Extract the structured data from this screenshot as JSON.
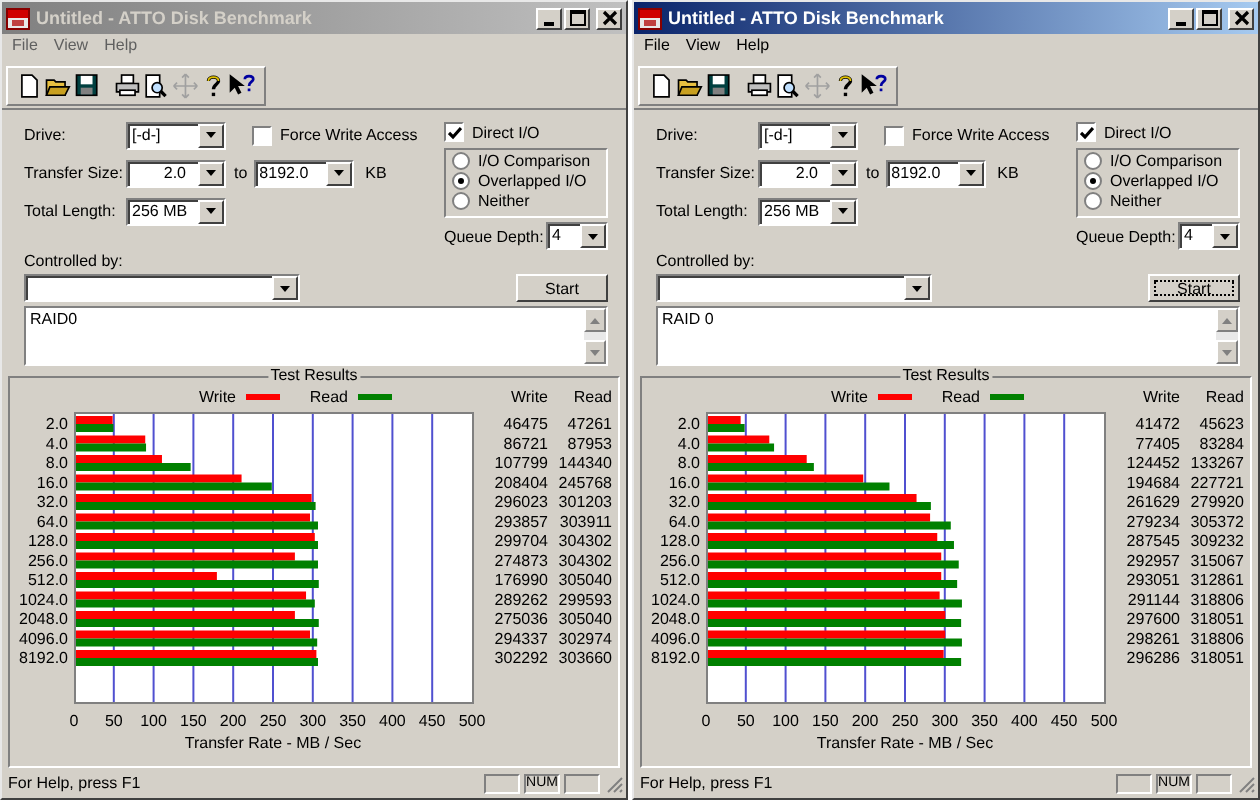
{
  "windows": [
    {
      "title": "Untitled - ATTO Disk Benchmark",
      "active": false,
      "menu": [
        "File",
        "View",
        "Help"
      ],
      "form": {
        "drive_label": "Drive:",
        "drive": "[-d-]",
        "transfer_size_label": "Transfer Size:",
        "transfer_from": "2.0",
        "to_label": "to",
        "transfer_to": "8192.0",
        "unit": "KB",
        "total_length_label": "Total Length:",
        "total_length": "256 MB",
        "force_write": {
          "label": "Force Write Access",
          "checked": false
        },
        "direct_io": {
          "label": "Direct I/O",
          "checked": true
        },
        "modes": [
          {
            "label": "I/O Comparison",
            "selected": false
          },
          {
            "label": "Overlapped I/O",
            "selected": true
          },
          {
            "label": "Neither",
            "selected": false
          }
        ],
        "queue_depth_label": "Queue Depth:",
        "queue_depth": "4",
        "controlled_by_label": "Controlled by:",
        "start_button": "Start",
        "description": "RAID0"
      },
      "results": {
        "title": "Test Results",
        "columns": [
          "Write",
          "Read"
        ],
        "rows": [
          {
            "write": "46475",
            "read": "47261"
          },
          {
            "write": "86721",
            "read": "87953"
          },
          {
            "write": "107799",
            "read": "144340"
          },
          {
            "write": "208404",
            "read": "245768"
          },
          {
            "write": "296023",
            "read": "301203"
          },
          {
            "write": "293857",
            "read": "303911"
          },
          {
            "write": "299704",
            "read": "304302"
          },
          {
            "write": "274873",
            "read": "304302"
          },
          {
            "write": "176990",
            "read": "305040"
          },
          {
            "write": "289262",
            "read": "299593"
          },
          {
            "write": "275036",
            "read": "305040"
          },
          {
            "write": "294337",
            "read": "302974"
          },
          {
            "write": "302292",
            "read": "303660"
          }
        ],
        "chart_data": {
          "type": "bar",
          "orientation": "horizontal",
          "xlabel": "Transfer Rate - MB / Sec",
          "categories": [
            "2.0",
            "4.0",
            "8.0",
            "16.0",
            "32.0",
            "64.0",
            "128.0",
            "256.0",
            "512.0",
            "1024.0",
            "2048.0",
            "4096.0",
            "8192.0"
          ],
          "xlim": [
            0,
            500
          ],
          "xticks": [
            0,
            50,
            100,
            150,
            200,
            250,
            300,
            350,
            400,
            450,
            500
          ],
          "series": [
            {
              "name": "Write",
              "color": "#ff0000",
              "values": [
                46,
                87,
                108,
                208,
                296,
                294,
                300,
                275,
                177,
                289,
                275,
                294,
                302
              ]
            },
            {
              "name": "Read",
              "color": "#008000",
              "values": [
                47,
                88,
                144,
                246,
                301,
                304,
                304,
                304,
                305,
                300,
                305,
                303,
                304
              ]
            }
          ],
          "grid": true,
          "legend": true
        }
      },
      "status": {
        "text": "For Help, press F1",
        "indicator": "NUM"
      }
    },
    {
      "title": "Untitled - ATTO Disk Benchmark",
      "active": true,
      "menu": [
        "File",
        "View",
        "Help"
      ],
      "form": {
        "drive_label": "Drive:",
        "drive": "[-d-]",
        "transfer_size_label": "Transfer Size:",
        "transfer_from": "2.0",
        "to_label": "to",
        "transfer_to": "8192.0",
        "unit": "KB",
        "total_length_label": "Total Length:",
        "total_length": "256 MB",
        "force_write": {
          "label": "Force Write Access",
          "checked": false
        },
        "direct_io": {
          "label": "Direct I/O",
          "checked": true
        },
        "modes": [
          {
            "label": "I/O Comparison",
            "selected": false
          },
          {
            "label": "Overlapped I/O",
            "selected": true
          },
          {
            "label": "Neither",
            "selected": false
          }
        ],
        "queue_depth_label": "Queue Depth:",
        "queue_depth": "4",
        "controlled_by_label": "Controlled by:",
        "start_button": "Start",
        "description": "RAID 0"
      },
      "results": {
        "title": "Test Results",
        "columns": [
          "Write",
          "Read"
        ],
        "rows": [
          {
            "write": "41472",
            "read": "45623"
          },
          {
            "write": "77405",
            "read": "83284"
          },
          {
            "write": "124452",
            "read": "133267"
          },
          {
            "write": "194684",
            "read": "227721"
          },
          {
            "write": "261629",
            "read": "279920"
          },
          {
            "write": "279234",
            "read": "305372"
          },
          {
            "write": "287545",
            "read": "309232"
          },
          {
            "write": "292957",
            "read": "315067"
          },
          {
            "write": "293051",
            "read": "312861"
          },
          {
            "write": "291144",
            "read": "318806"
          },
          {
            "write": "297600",
            "read": "318051"
          },
          {
            "write": "298261",
            "read": "318806"
          },
          {
            "write": "296286",
            "read": "318051"
          }
        ],
        "chart_data": {
          "type": "bar",
          "orientation": "horizontal",
          "xlabel": "Transfer Rate - MB / Sec",
          "categories": [
            "2.0",
            "4.0",
            "8.0",
            "16.0",
            "32.0",
            "64.0",
            "128.0",
            "256.0",
            "512.0",
            "1024.0",
            "2048.0",
            "4096.0",
            "8192.0"
          ],
          "xlim": [
            0,
            500
          ],
          "xticks": [
            0,
            50,
            100,
            150,
            200,
            250,
            300,
            350,
            400,
            450,
            500
          ],
          "series": [
            {
              "name": "Write",
              "color": "#ff0000",
              "values": [
                41,
                77,
                124,
                195,
                262,
                279,
                288,
                293,
                293,
                291,
                298,
                298,
                296
              ]
            },
            {
              "name": "Read",
              "color": "#008000",
              "values": [
                46,
                83,
                133,
                228,
                280,
                305,
                309,
                315,
                313,
                319,
                318,
                319,
                318
              ]
            }
          ],
          "grid": true,
          "legend": true
        }
      },
      "status": {
        "text": "For Help, press F1",
        "indicator": "NUM"
      }
    }
  ]
}
